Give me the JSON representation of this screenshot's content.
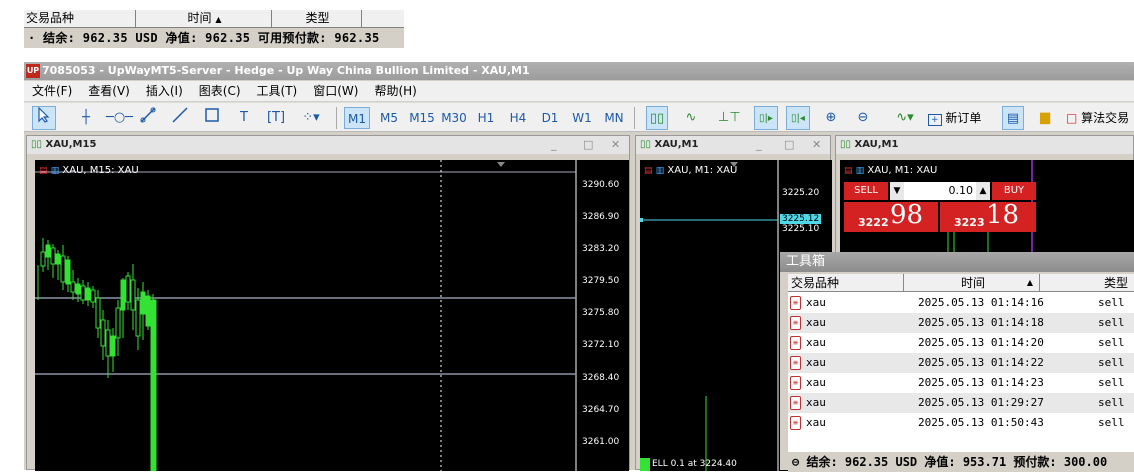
{
  "top_panel": {
    "headers": [
      "交易品种",
      "时间",
      "类型"
    ],
    "balance_line": "· 结余: 962.35 USD  净值: 962.35  可用预付款: 962.35"
  },
  "window": {
    "title": "7085053 - UpWayMT5-Server - Hedge - Up Way China Bullion Limited - XAU,M1",
    "logo": "UP"
  },
  "menu": [
    "文件(F)",
    "查看(V)",
    "插入(I)",
    "图表(C)",
    "工具(T)",
    "窗口(W)",
    "帮助(H)"
  ],
  "toolbar": {
    "timeframes": [
      "M1",
      "M5",
      "M15",
      "M30",
      "H1",
      "H4",
      "D1",
      "W1",
      "MN"
    ],
    "active_timeframe": "M1",
    "new_order_label": "新订单",
    "algo_label": "算法交易"
  },
  "chart_m15": {
    "title": "XAU,M15",
    "label": "XAU, M15:  XAU",
    "price_labels": [
      "3290.60",
      "3286.90",
      "3283.20",
      "3279.50",
      "3275.80",
      "3272.10",
      "3268.40",
      "3264.70",
      "3261.00"
    ]
  },
  "chart_m1a": {
    "title": "XAU,M1",
    "label": "XAU, M1:  XAU",
    "price_labels": [
      "3225.20",
      "3225.12",
      "3225.10"
    ],
    "bottom_label": "ELL 0.1 at 3224.40"
  },
  "chart_m1b": {
    "title": "XAU,M1",
    "label": "XAU, M1:  XAU",
    "sell_label": "SELL",
    "buy_label": "BUY",
    "volume": "0.10",
    "sell_price_small": "3222",
    "sell_price_big": "98",
    "buy_price_small": "3223",
    "buy_price_big": "18"
  },
  "toolbox": {
    "title": "工具箱",
    "headers": [
      "交易品种",
      "时间",
      "类型"
    ],
    "rows": [
      {
        "symbol": "xau",
        "time": "2025.05.13 01:14:16",
        "type": "sell"
      },
      {
        "symbol": "xau",
        "time": "2025.05.13 01:14:18",
        "type": "sell"
      },
      {
        "symbol": "xau",
        "time": "2025.05.13 01:14:20",
        "type": "sell"
      },
      {
        "symbol": "xau",
        "time": "2025.05.13 01:14:22",
        "type": "sell"
      },
      {
        "symbol": "xau",
        "time": "2025.05.13 01:14:23",
        "type": "sell"
      },
      {
        "symbol": "xau",
        "time": "2025.05.13 01:29:27",
        "type": "sell"
      },
      {
        "symbol": "xau",
        "time": "2025.05.13 01:50:43",
        "type": "sell"
      }
    ],
    "balance_line": "⊖ 结余: 962.35 USD  净值: 953.71  预付款: 300.00"
  }
}
